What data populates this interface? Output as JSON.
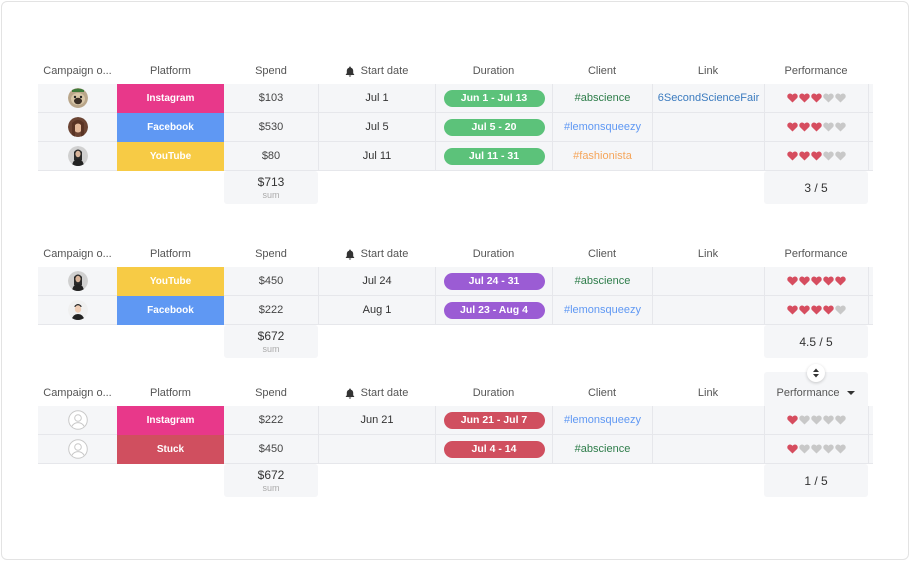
{
  "colors": {
    "instagram": "#e8388a",
    "facebook": "#5f98f3",
    "youtube": "#f7cb45",
    "stuck": "#d04f5f",
    "pill_green": "#5cc27a",
    "pill_purple": "#9b5cd4",
    "pill_red": "#d04f5f",
    "client_abscience": "#2e7d4a",
    "client_lemonsqueezy": "#5f98f3",
    "client_fashionista": "#f5a55a",
    "link": "#3b7bbf",
    "heart_on": "#d64d5f",
    "heart_off": "#c8c8c8"
  },
  "columns": {
    "campaign": "Campaign o...",
    "platform": "Platform",
    "spend": "Spend",
    "start_date": "Start date",
    "duration": "Duration",
    "client": "Client",
    "link": "Link",
    "performance": "Performance"
  },
  "groups": [
    {
      "rows": [
        {
          "avatar": "pug-avatar",
          "platform": "Instagram",
          "platform_color": "instagram",
          "spend": "$103",
          "start": "Jul 1",
          "duration": "Jun 1 - Jul 13",
          "pill": "pill_green",
          "client": "#abscience",
          "client_color": "client_abscience",
          "link": "6SecondScienceFair",
          "rating": 3
        },
        {
          "avatar": "woman-avatar",
          "platform": "Facebook",
          "platform_color": "facebook",
          "spend": "$530",
          "start": "Jul 5",
          "duration": "Jul 5 - 20",
          "pill": "pill_green",
          "client": "#lemonsqueezy",
          "client_color": "client_lemonsqueezy",
          "link": "",
          "rating": 3
        },
        {
          "avatar": "woman-dark-avatar",
          "platform": "YouTube",
          "platform_color": "youtube",
          "spend": "$80",
          "start": "Jul 11",
          "duration": "Jul 11 - 31",
          "pill": "pill_green",
          "client": "#fashionista",
          "client_color": "client_fashionista",
          "link": "",
          "rating": 3
        }
      ],
      "sum": "$713",
      "sum_label": "sum",
      "performance_avg": "3 / 5"
    },
    {
      "rows": [
        {
          "avatar": "woman-dark-avatar",
          "platform": "YouTube",
          "platform_color": "youtube",
          "spend": "$450",
          "start": "Jul 24",
          "duration": "Jul 24 - 31",
          "pill": "pill_purple",
          "client": "#abscience",
          "client_color": "client_abscience",
          "link": "",
          "rating": 5
        },
        {
          "avatar": "man-avatar",
          "platform": "Facebook",
          "platform_color": "facebook",
          "spend": "$222",
          "start": "Aug 1",
          "duration": "Jul 23 - Aug 4",
          "pill": "pill_purple",
          "client": "#lemonsqueezy",
          "client_color": "client_lemonsqueezy",
          "link": "",
          "rating": 4
        }
      ],
      "sum": "$672",
      "sum_label": "sum",
      "performance_avg": "4.5 / 5"
    },
    {
      "rows": [
        {
          "avatar": "empty-avatar",
          "platform": "Instagram",
          "platform_color": "instagram",
          "spend": "$222",
          "start": "Jun 21",
          "duration": "Jun 21 - Jul 7",
          "pill": "pill_red",
          "client": "#lemonsqueezy",
          "client_color": "client_lemonsqueezy",
          "link": "",
          "rating": 1
        },
        {
          "avatar": "empty-avatar",
          "platform": "Stuck",
          "platform_color": "stuck",
          "spend": "$450",
          "start": "",
          "duration": "Jul 4 - 14",
          "pill": "pill_red",
          "client": "#abscience",
          "client_color": "client_abscience",
          "link": "",
          "rating": 1
        }
      ],
      "sum": "$672",
      "sum_label": "sum",
      "performance_avg": "1 / 5"
    }
  ]
}
